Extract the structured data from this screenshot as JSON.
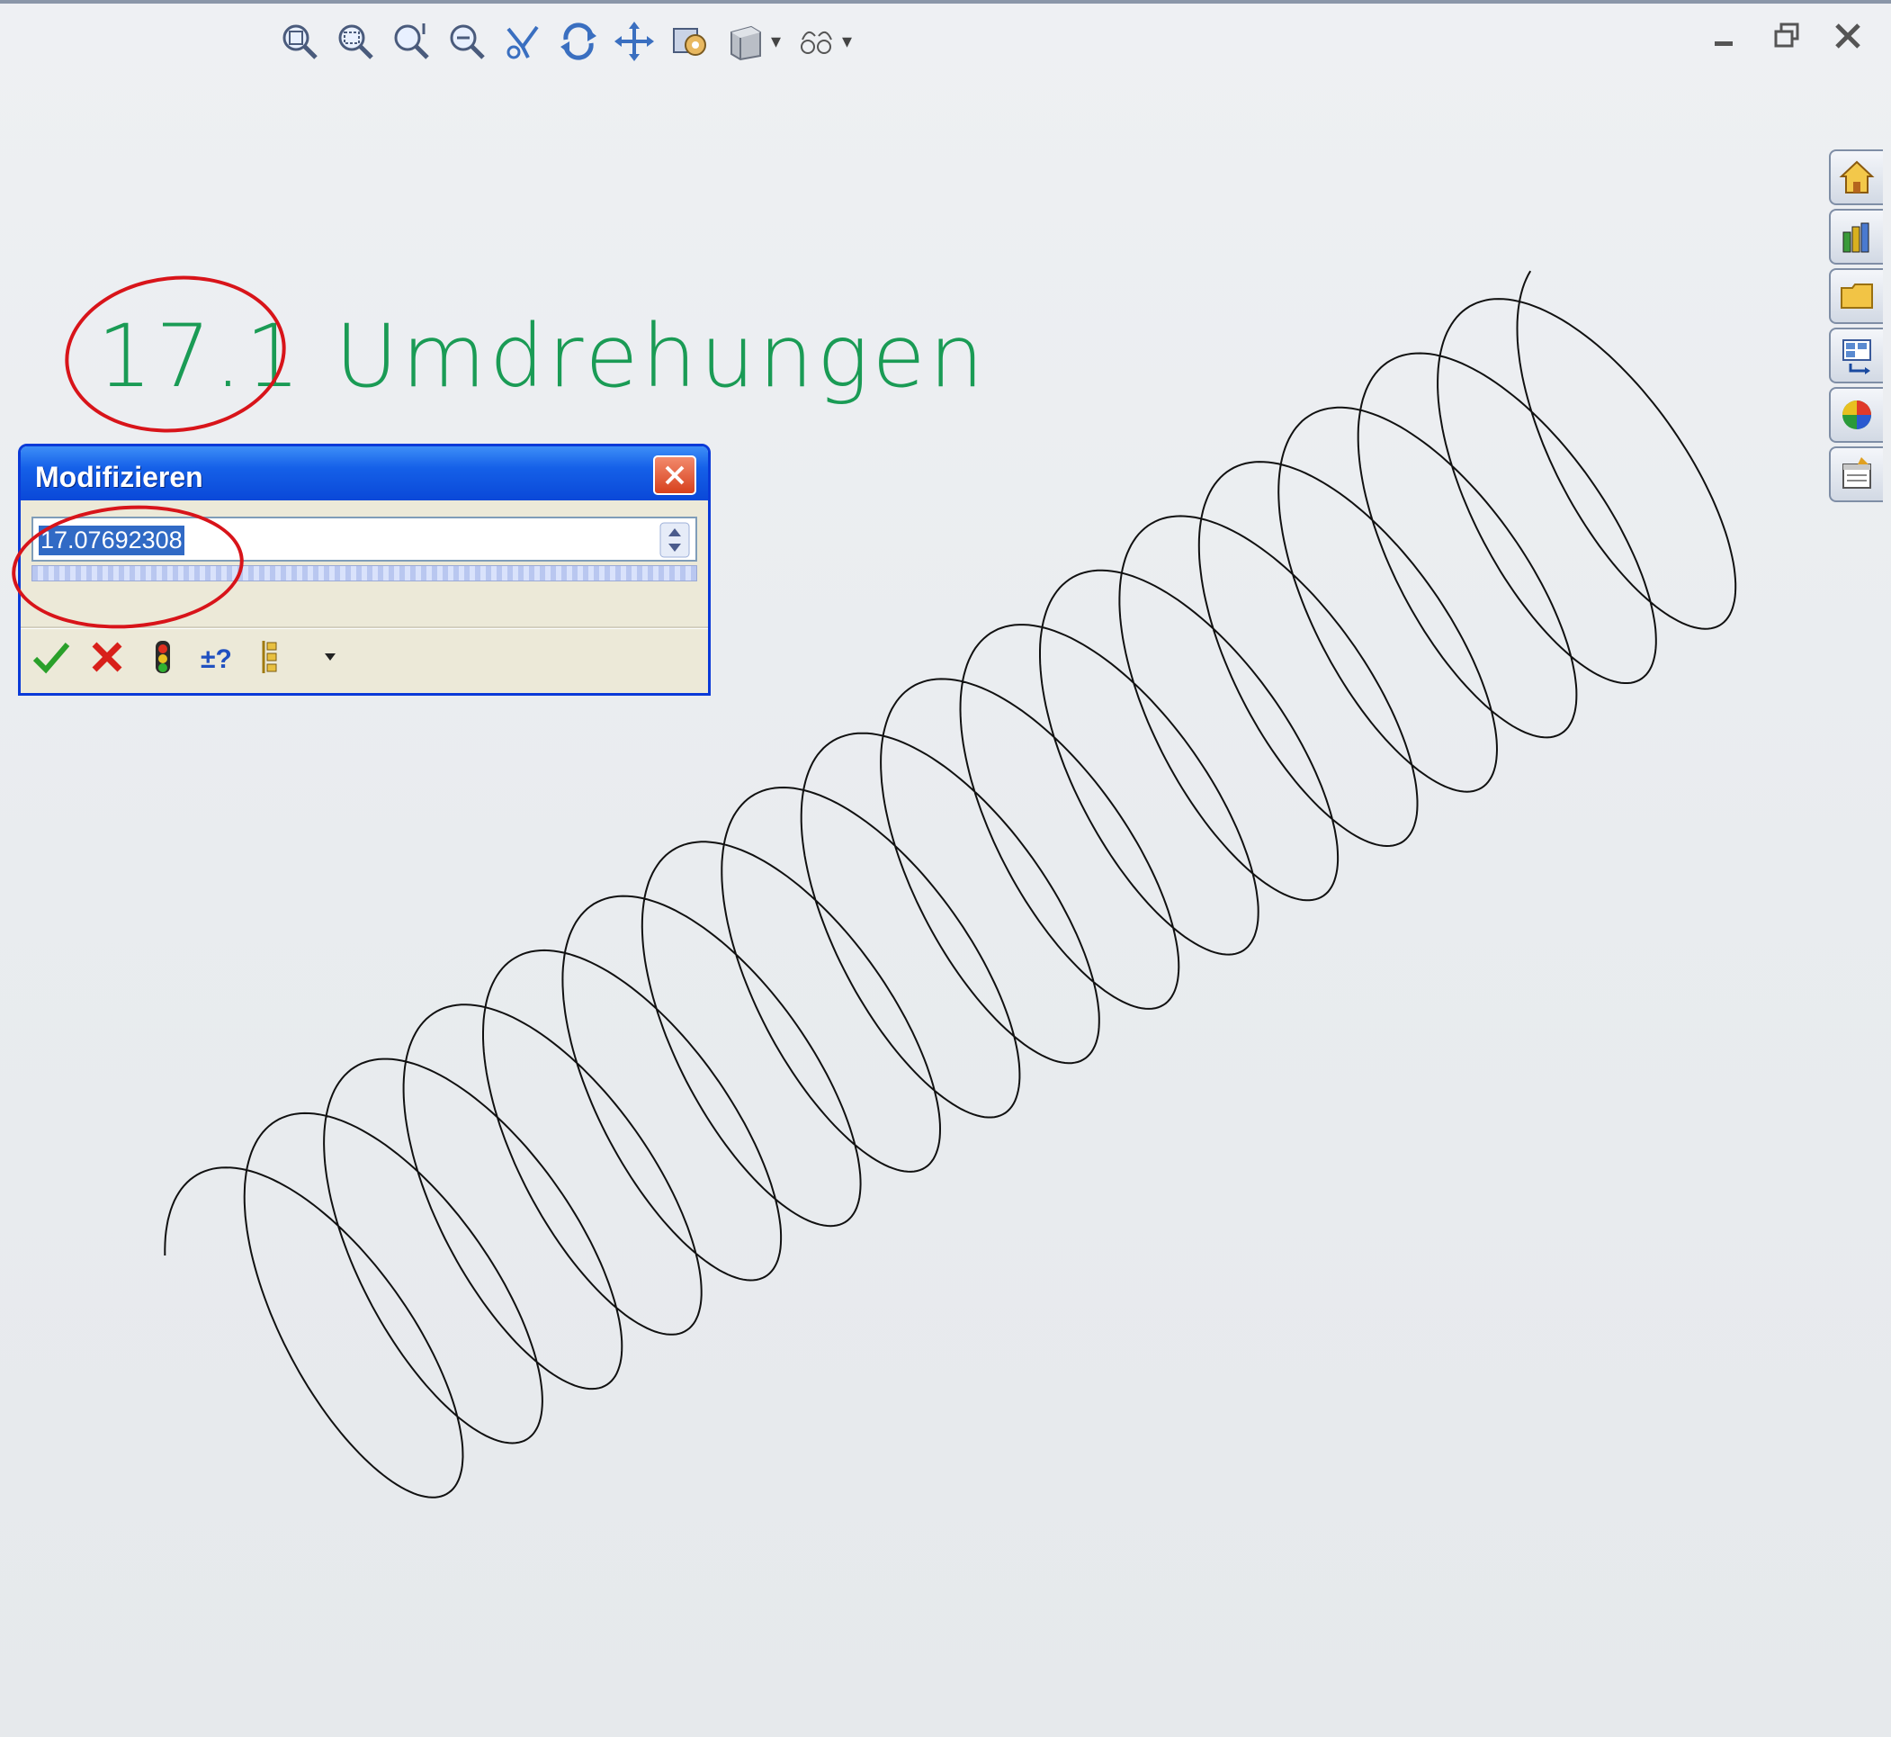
{
  "annotation": {
    "title_number": "17.1",
    "title_word": "Umdrehungen"
  },
  "modify_dialog": {
    "title": "Modifizieren",
    "value": "17.07692308"
  },
  "view_toolbar": {
    "icons": [
      "zoom-to-fit-icon",
      "zoom-to-area-icon",
      "zoom-in-out-icon",
      "zoom-to-selection-icon",
      "rotate-view-icon",
      "rotate-icon",
      "pan-icon",
      "view-orientation-icon",
      "display-style-icon",
      "hide-show-icon"
    ]
  },
  "task_pane": {
    "tabs": [
      "solidworks-resources-icon",
      "design-library-icon",
      "file-explorer-icon",
      "view-palette-icon",
      "appearances-icon",
      "custom-properties-icon"
    ]
  },
  "colors": {
    "annotation_text": "#1a9b55",
    "highlight": "#d8141a",
    "dialog_titlebar": "#0a48d8",
    "selection": "#316ac5"
  }
}
